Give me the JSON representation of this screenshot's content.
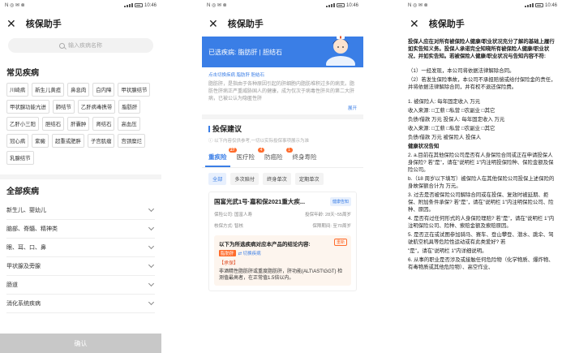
{
  "status": {
    "left": "N ◎ ✉ ⊗",
    "time": "10:46"
  },
  "app": {
    "title": "核保助手"
  },
  "p1": {
    "search_placeholder": "输入疾病名称",
    "common_title": "常见疾病",
    "common_tags": [
      "川崎病",
      "新生儿黄疸",
      "鼻息肉",
      "白内障",
      "甲状腺结节",
      "甲状腺功能亢进",
      "肺结节",
      "乙肝病毒携带",
      "脂肪肝",
      "乙肝小三阳",
      "胆结石",
      "肝囊肿",
      "肾结石",
      "高血压",
      "冠心病",
      "紫癜",
      "超重或肥胖",
      "子宫肌瘤",
      "宫颈糜烂",
      "乳腺结节"
    ],
    "all_title": "全部疾病",
    "all_items": [
      "新生儿、婴幼儿",
      "脑部、脊髓、精神类",
      "眼、耳、口、鼻",
      "甲状腺及旁腺",
      "肠道",
      "消化系统疾病"
    ],
    "confirm": "确认"
  },
  "p2": {
    "banner": "已选疾病: 脂肪肝 | 胆结石",
    "switch_left": "点击切换疾病  脂肪肝  胆结石",
    "desc": "脂肪肝，是指由于各种原因引起的肝细胞内脂肪堆积过多的病变。脂肪性肝病正严重威胁国人的健康，成为仅次于病毒性肝炎的第二大肝病，已被公认为隐匿性肝",
    "expand": "展开",
    "advice_title": "投保建议",
    "note": "以下内容仅供参考,一切以实际投保事项展示为准",
    "tabs": [
      {
        "label": "重疾险",
        "badge": "27"
      },
      {
        "label": "医疗险",
        "badge": "4"
      },
      {
        "label": "防癌险",
        "badge": "1"
      },
      {
        "label": "终身寿险",
        "badge": ""
      }
    ],
    "filters": [
      "全部",
      "多次赔付",
      "终身单次",
      "定期单次"
    ],
    "card": {
      "title": "国富光武1号·嘉和保2021重大疾...",
      "btn": "健康告知",
      "company": "保险公司: 国富人寿",
      "age": "投保年龄: 28天~55周岁",
      "method": "核保方式: 智核",
      "period": "保障期间: 至70周岁",
      "res_title": "以下为所选疾病对应本产品的结论内容:",
      "res_badge": "重新",
      "res_disease": "脂肪肝",
      "res_switch": "切换疾病",
      "res_conclusion": "【承保】",
      "res_text": "非酒精性脂肪肝或重度脂肪肝，肝功能(ALT\\AST\\GGT) 检测值最高者，在正常值1.5倍以内。"
    }
  },
  "p3": {
    "lines": [
      {
        "t": "投保人应在对所有被保险人健康/职业状况充分了解的基础上履行如实告知义务。投保人承诺完全知晓所有被保险人健康/职业状况，并如实告知。若被保险人健康/职业状况与告知内容不符:",
        "b": true
      },
      {
        "t": "",
        "b": false
      },
      {
        "t": "（1）一经发现，本公司将依据法律解除合同。",
        "b": false
      },
      {
        "t": "（2）若发生保险事故，本公司不承担赔偿或给付保险金的责任，并将依据法律解除合同，并有权不退还保险费。",
        "b": false
      },
      {
        "t": "",
        "b": false
      },
      {
        "t": "1. 被保险人:  每年固定收入  万元",
        "b": false
      },
      {
        "t": "收入来源: □工薪 □私营 □农副业 □其它",
        "b": false
      },
      {
        "t": "负债/借款 万元   投保人:   每年固定收入     万元",
        "b": false
      },
      {
        "t": "收入来源: □工薪 □私营 □农副业 □其它",
        "b": false
      },
      {
        "t": "负债/借款 万元   被保险人   投保人",
        "b": false
      },
      {
        "t": "健康状况告知",
        "b": true
      },
      {
        "t": "2. a.目前在其他保险公司是否有人身保险合同或正在申请投保人身保险? 若\"是\"，请在\"说明栏 1\"内注明投保险种、保险金额及保险公司。",
        "b": false
      },
      {
        "t": "b.（18 周岁以下填写）被保险人在其他保险公司投保上述保险的身故保额合计为 万元。",
        "b": false
      },
      {
        "t": "3. 过去是否被保险公司解除合同或在投保、复效时被延期、拒保、附加条件承保? 若\"是\"，请在\"说明栏 1\"内注明保险公司、险种、原因。",
        "b": false
      },
      {
        "t": "4. 是否有过任何形式的人身保险理赔? 若\"是\"，请在\"说明栏 1\"内注明保险公司、险种、索赔金额及索赔原因。",
        "b": false
      },
      {
        "t": "5. 是否正在或试图参加骑马、赛车、登山攀登、潜水、跳伞、驾驶航空机具等危险性运动或有此类爱好? 若",
        "b": false
      },
      {
        "t": "\"是\"，请在\"说明栏 1\"内详细说明。",
        "b": false
      },
      {
        "t": "6. 从事的职业是否涉及或接触任何危险物（化学物质、爆炸物、有毒物质或其他危险物）、高空作业、",
        "b": false
      }
    ]
  }
}
